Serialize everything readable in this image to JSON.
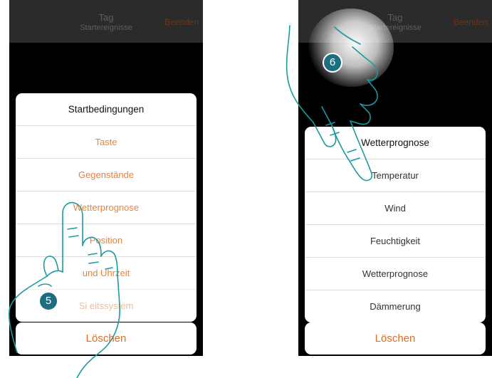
{
  "left": {
    "topbar": {
      "title": "Tag",
      "subtitle": "Startereignisse",
      "end_label": "Beenden"
    },
    "menu": {
      "title": "Startbedingungen",
      "options": [
        "Taste",
        "Gegenstände",
        "Wetterprognose",
        "Position",
        "und Uhrzeit",
        "Si    eitssystem"
      ]
    },
    "cancel_label": "Löschen",
    "step_badge": "5"
  },
  "right": {
    "topbar": {
      "title": "Tag",
      "subtitle": "Startereignisse",
      "end_label": "Beenden"
    },
    "menu": {
      "title": "Wetterprognose",
      "options": [
        "Temperatur",
        "Wind",
        "Feuchtigkeit",
        "Wetterprognose",
        "Dämmerung"
      ]
    },
    "cancel_label": "Löschen",
    "step_badge": "6"
  },
  "colors": {
    "accent_orange": "#e8823c",
    "badge_teal": "#1f6e80",
    "hand_outline": "#1a9aa0"
  }
}
